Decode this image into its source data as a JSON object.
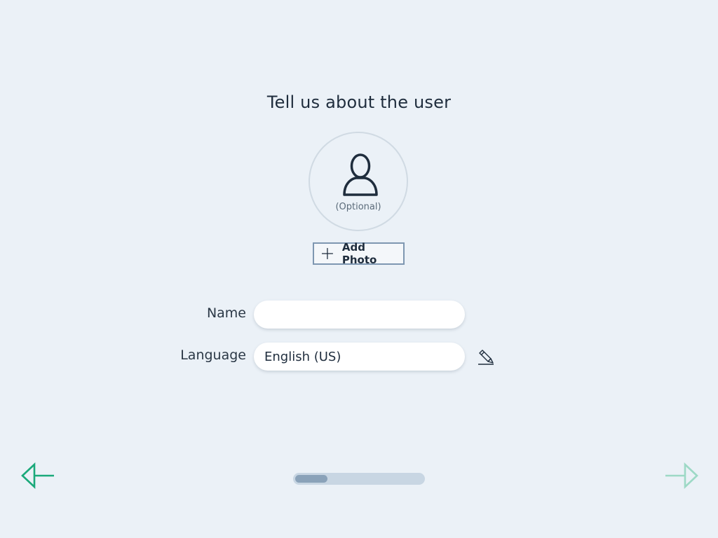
{
  "page": {
    "title": "Tell us about the user"
  },
  "avatar": {
    "icon": "person-icon",
    "hint": "(Optional)"
  },
  "add_photo": {
    "icon": "plus-icon",
    "label": "Add Photo"
  },
  "form": {
    "name": {
      "label": "Name",
      "value": ""
    },
    "language": {
      "label": "Language",
      "value": "English (US)",
      "edit_icon": "pencil-icon"
    }
  },
  "navigation": {
    "back_icon": "back-arrow-icon",
    "next_icon": "next-arrow-icon",
    "next_enabled": false,
    "progress": 0.25
  },
  "colors": {
    "background": "#ebf1f7",
    "accent": "#1aa97a",
    "accent_disabled": "#9dd9c6",
    "text": "#1f2d3d",
    "progress_track": "#c8d6e3",
    "progress_fill": "#8aa2b9"
  }
}
